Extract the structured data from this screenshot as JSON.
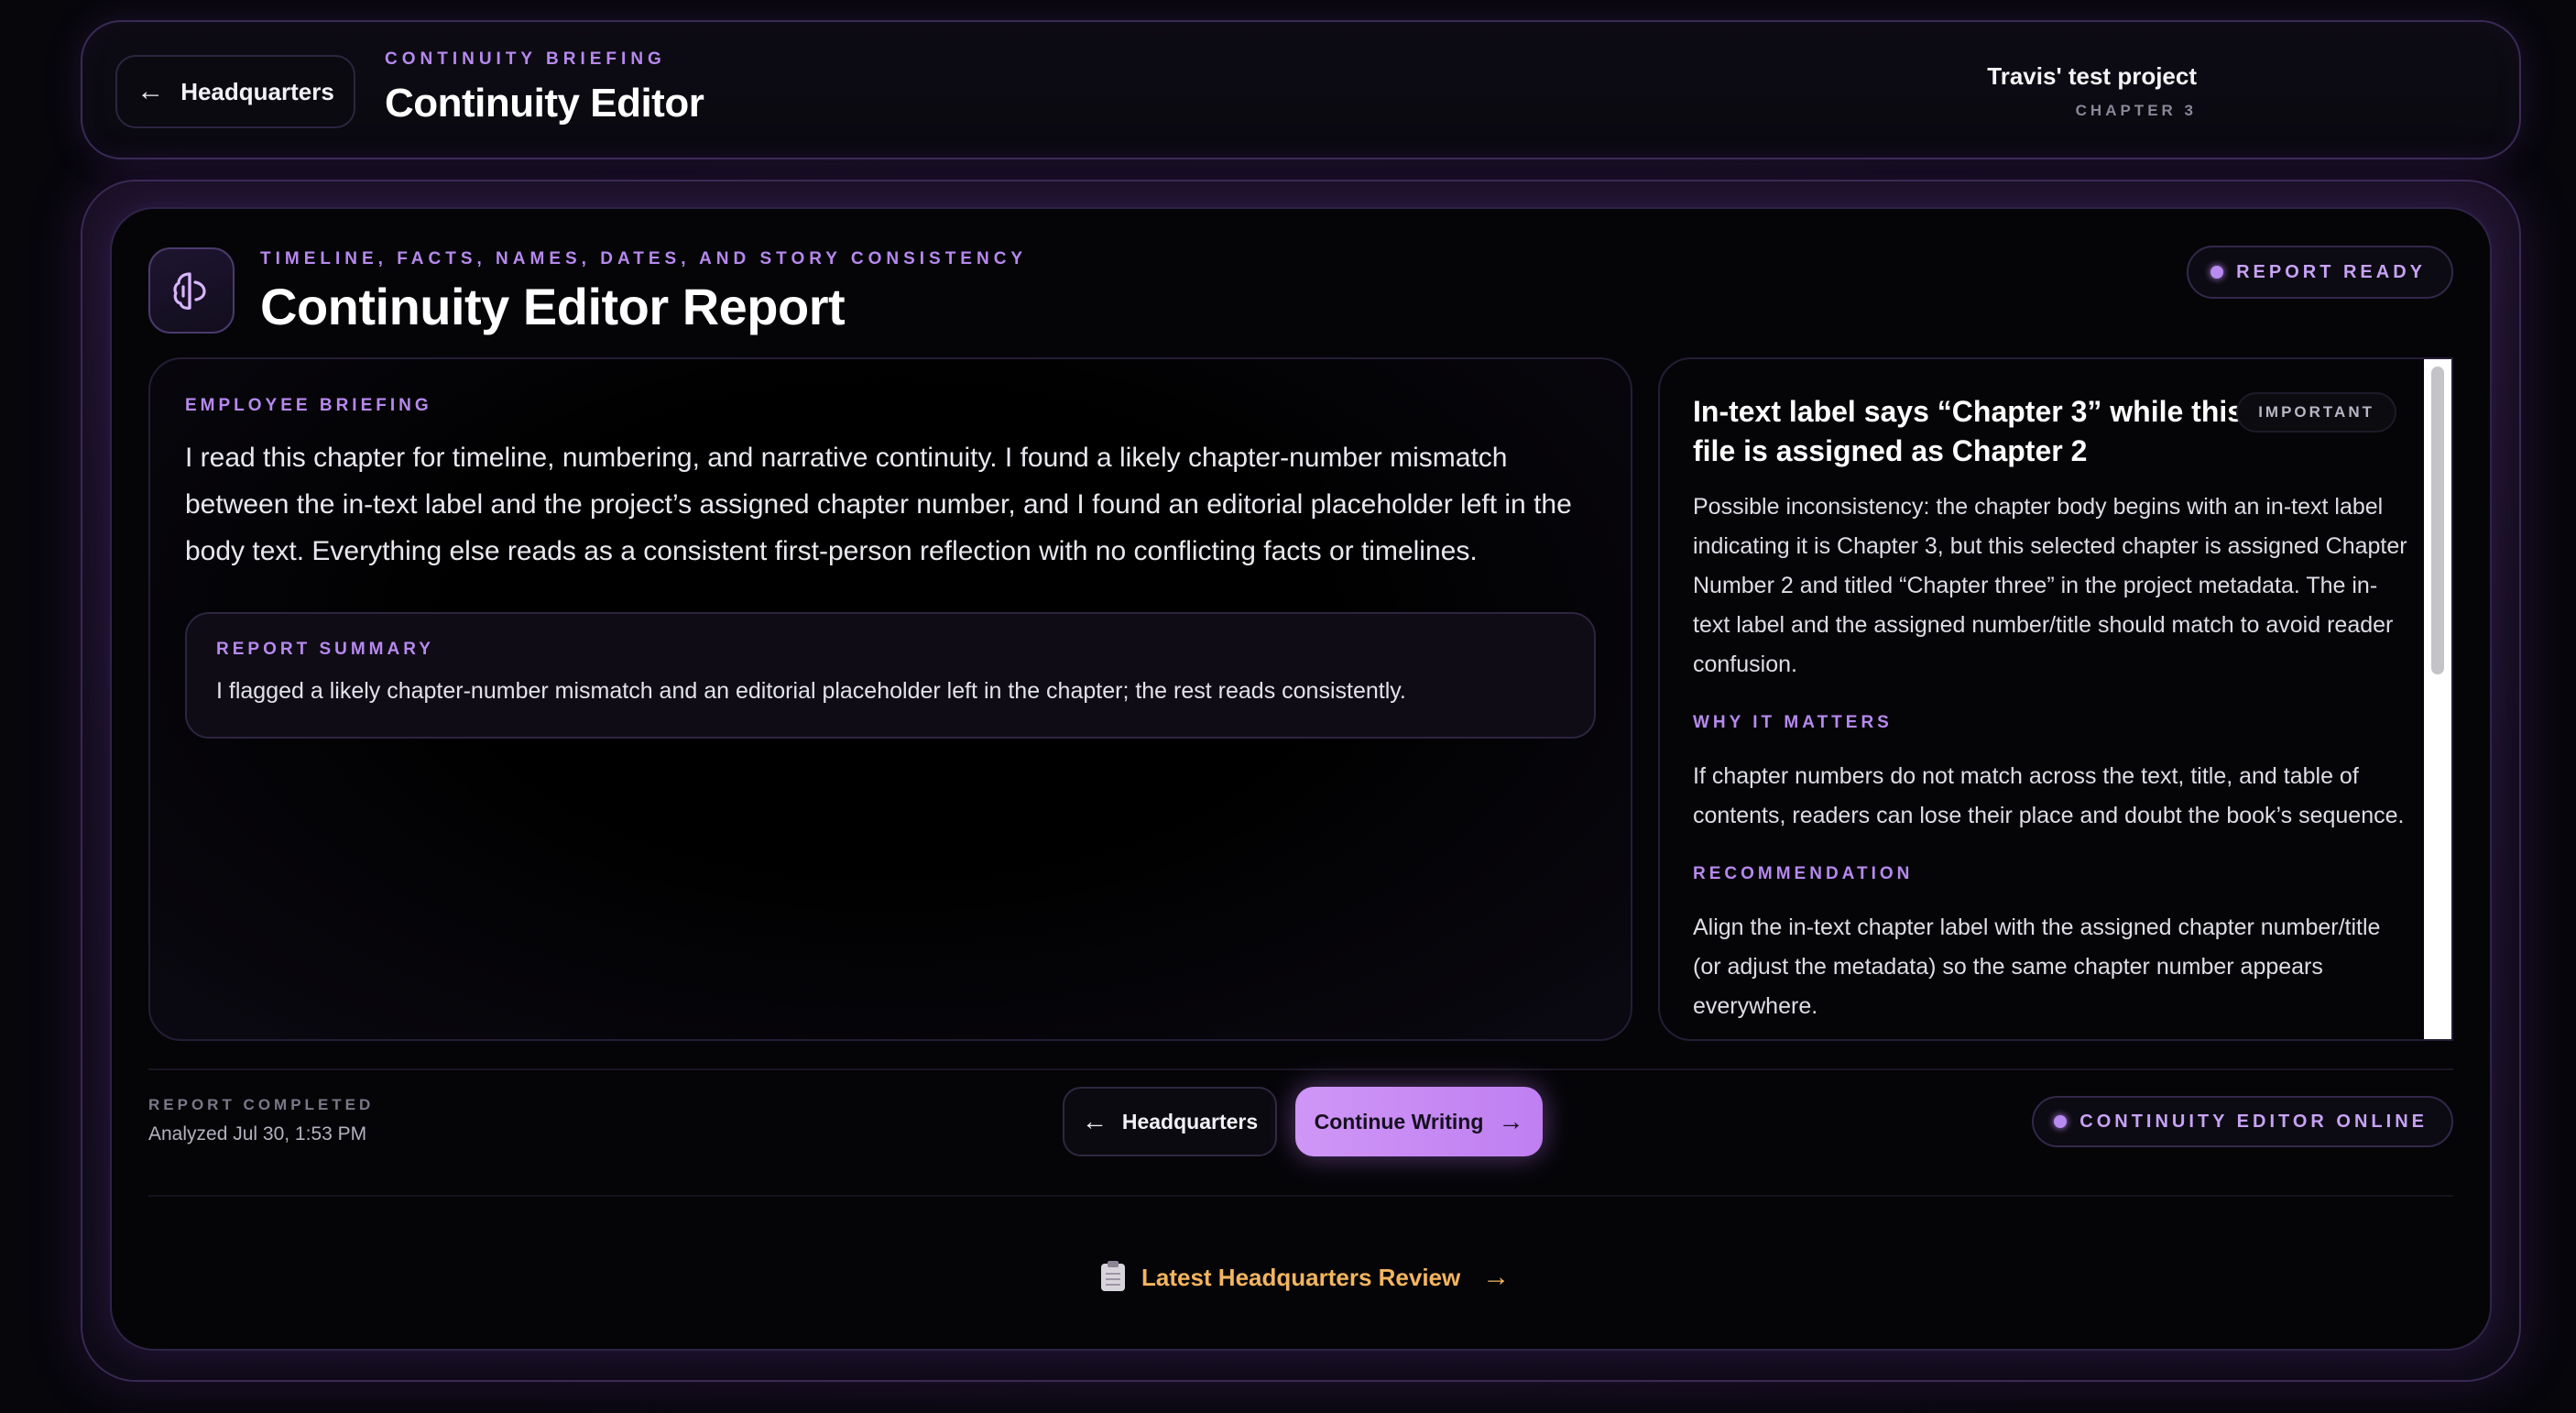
{
  "header": {
    "back_label": "Headquarters",
    "eyebrow": "CONTINUITY BRIEFING",
    "title": "Continuity Editor",
    "project_name": "Travis' test project",
    "chapter_label": "CHAPTER 3"
  },
  "report": {
    "eyebrow": "TIMELINE, FACTS, NAMES, DATES, AND STORY CONSISTENCY",
    "title": "Continuity Editor Report",
    "status": "REPORT READY",
    "icon": "brain-icon"
  },
  "briefing": {
    "label": "EMPLOYEE BRIEFING",
    "text": "I read this chapter for timeline, numbering, and narrative continuity. I found a likely chapter-number mismatch between the in-text label and the project’s assigned chapter number, and I found an editorial placeholder left in the body text. Everything else reads as a consistent first-person reflection with no conflicting facts or timelines.",
    "summary_label": "REPORT SUMMARY",
    "summary_text": "I flagged a likely chapter-number mismatch and an editorial placeholder left in the chapter; the rest reads consistently."
  },
  "issue": {
    "title": "In-text label says “Chapter 3” while this file is assigned as Chapter 2",
    "severity": "IMPORTANT",
    "description": "Possible inconsistency: the chapter body begins with an in-text label indicating it is Chapter 3, but this selected chapter is assigned Chapter Number 2 and titled “Chapter three” in the project metadata. The in-text label and the assigned number/title should match to avoid reader confusion.",
    "why_label": "WHY IT MATTERS",
    "why_text": "If chapter numbers do not match across the text, title, and table of contents, readers can lose their place and doubt the book’s sequence.",
    "rec_label": "RECOMMENDATION",
    "rec_text": "Align the in-text chapter label with the assigned chapter number/title (or adjust the metadata) so the same chapter number appears everywhere."
  },
  "footer": {
    "completed_label": "REPORT COMPLETED",
    "completed_date": "Analyzed Jul 30, 1:53 PM",
    "back_label": "Headquarters",
    "continue_label": "Continue Writing",
    "online_status": "CONTINUITY EDITOR ONLINE",
    "latest_link": "Latest Headquarters Review"
  },
  "colors": {
    "accent": "#b789ee",
    "button": "#c98cf4",
    "link": "#f3b55f",
    "background": "#050508"
  }
}
